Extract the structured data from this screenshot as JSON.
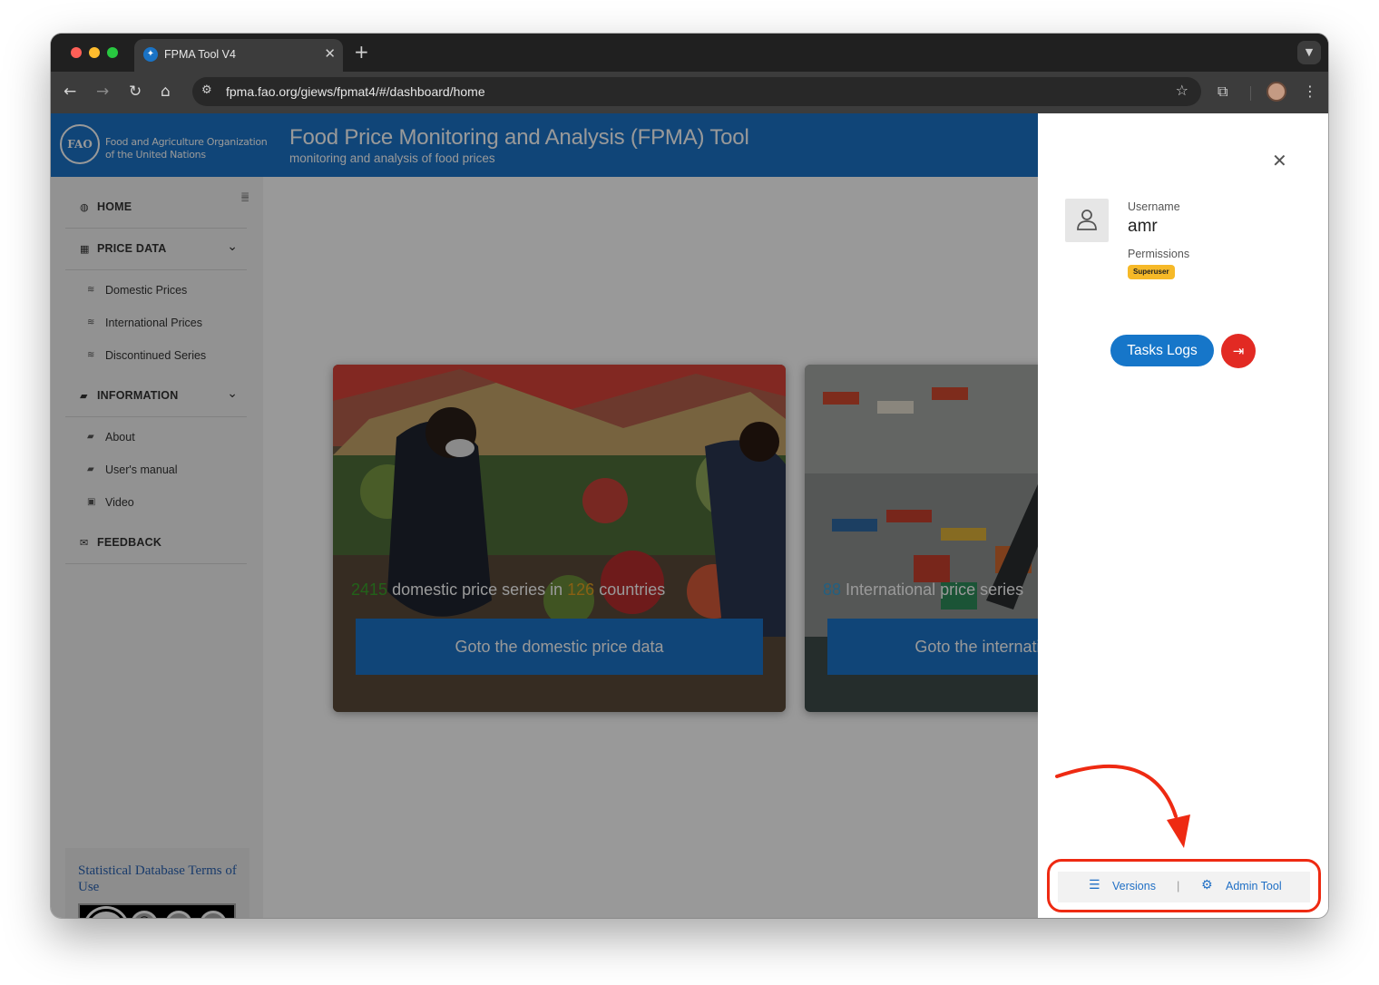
{
  "browser": {
    "tab_title": "FPMA Tool V4",
    "url": "fpma.fao.org/giews/fpmat4/#/dashboard/home"
  },
  "header": {
    "org_name_line1": "Food and Agriculture Organization",
    "org_name_line2": "of the United Nations",
    "title": "Food Price Monitoring and Analysis (FPMA) Tool",
    "subtitle": "monitoring and analysis of food prices"
  },
  "sidebar": {
    "home": "HOME",
    "price_data": "PRICE DATA",
    "price_items": [
      "Domestic Prices",
      "International Prices",
      "Discontinued Series"
    ],
    "information": "INFORMATION",
    "info_items": [
      "About",
      "User's manual",
      "Video"
    ],
    "feedback": "FEEDBACK",
    "terms_link": "Statistical Database Terms of Use",
    "license": {
      "by": "BY",
      "nc": "NC",
      "sa": "SA",
      "cc": "cc"
    }
  },
  "cards": [
    {
      "count": "2415",
      "text_mid": "domestic price series in",
      "count2": "126",
      "text_end": "countries",
      "button": "Goto the domestic price data"
    },
    {
      "count": "88",
      "text_mid": "International price series",
      "button": "Goto the international price data"
    }
  ],
  "drawer": {
    "username_label": "Username",
    "username": "amr",
    "permissions_label": "Permissions",
    "permission_badge": "Superuser",
    "tasks_logs": "Tasks Logs",
    "versions": "Versions",
    "admin_tool": "Admin Tool"
  },
  "colors": {
    "brand_blue": "#1b74c9",
    "danger_red": "#e22a23",
    "badge_yellow": "#f6b928",
    "count_green": "#3aa32b",
    "count_orange": "#e5a021",
    "count_cyan": "#3aa0d8",
    "annotation_red": "#ee2a12"
  }
}
